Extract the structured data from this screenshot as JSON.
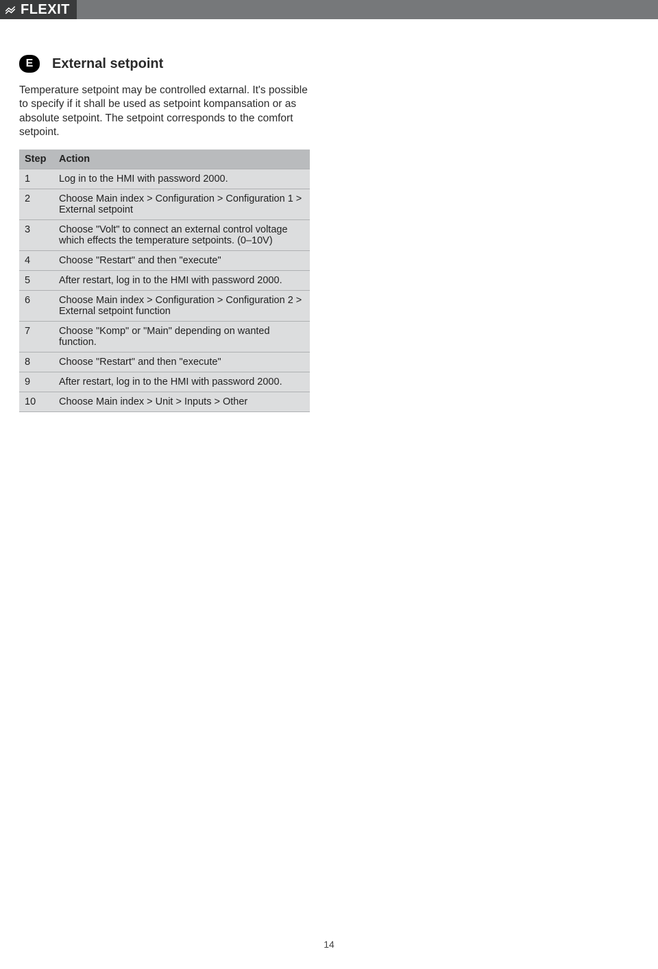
{
  "brand": {
    "name": "FLEXIT"
  },
  "section": {
    "badge": "E",
    "title": "External setpoint",
    "intro": "Temperature setpoint may be controlled extarnal. It's possible to specify if it shall be used as setpoint kompansation or as absolute setpoint. The setpoint corresponds to the comfort setpoint."
  },
  "table": {
    "headers": {
      "step": "Step",
      "action": "Action"
    },
    "rows": [
      {
        "step": "1",
        "action": "Log in to the HMI with password 2000."
      },
      {
        "step": "2",
        "action": "Choose Main index > Configuration > Configuration 1 > External setpoint"
      },
      {
        "step": "3",
        "action": "Choose \"Volt\" to connect an external control voltage which effects the temperature setpoints. (0–10V)"
      },
      {
        "step": "4",
        "action": "Choose \"Restart\" and then \"execute\""
      },
      {
        "step": "5",
        "action": "After restart, log in to the HMI with password 2000."
      },
      {
        "step": "6",
        "action": "Choose Main index > Configuration > Configuration 2 > External setpoint function"
      },
      {
        "step": "7",
        "action": "Choose \"Komp\" or \"Main\" depending on wanted function."
      },
      {
        "step": "8",
        "action": "Choose \"Restart\" and then \"execute\""
      },
      {
        "step": "9",
        "action": "After restart, log in to the HMI with password 2000."
      },
      {
        "step": "10",
        "action": "Choose Main index > Unit > Inputs > Other"
      }
    ]
  },
  "page_number": "14"
}
